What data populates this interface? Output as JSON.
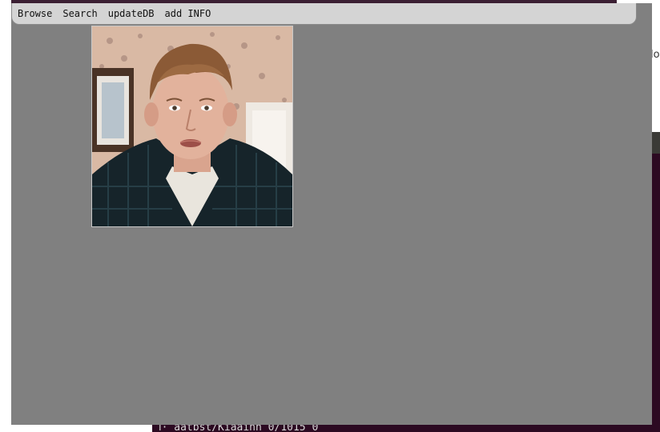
{
  "app": {
    "menu": [
      {
        "key": "browse",
        "label": "Browse"
      },
      {
        "key": "search",
        "label": "Search"
      },
      {
        "key": "updatedb",
        "label": "updateDB"
      },
      {
        "key": "addinfo",
        "label": "add INFO"
      }
    ]
  },
  "background": {
    "terminal_line": "ⅰ· aatbst/Kiaainn 0/1015 0",
    "window_edge_text": "lo"
  },
  "colors": {
    "window_bg": "#808080",
    "menubar_bg": "#d4d4d4",
    "terminal_bg": "#2c0a22"
  },
  "icons": {
    "photo": "person-photo"
  }
}
